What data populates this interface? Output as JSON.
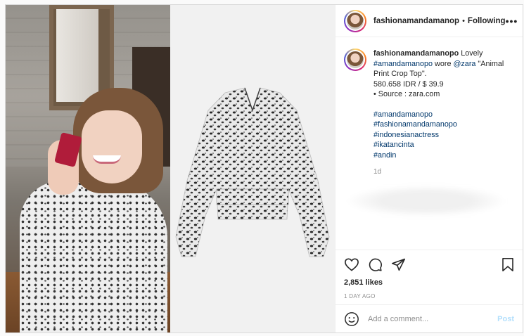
{
  "header": {
    "username": "fashionamandamanop",
    "separator": "•",
    "follow_status": "Following",
    "more_label": "•••"
  },
  "caption": {
    "username": "fashionamandamanopo",
    "line1_text": "Lovely",
    "mention_user": "#amandamanopo",
    "wore_text": "wore",
    "mention_brand": "@zara",
    "product_text": "\"Animal Print Crop Top\".",
    "price": "580.658 IDR / $ 39.9",
    "source": "• Source : zara.com",
    "hashtags": [
      "#amandamanopo",
      "#fashionamandamanopo",
      "#indonesianactress",
      "#ikatancinta",
      "#andin"
    ],
    "time": "1d"
  },
  "actions": {
    "likes": "2,851 likes",
    "date": "1 DAY AGO"
  },
  "comment": {
    "placeholder": "Add a comment...",
    "post_label": "Post"
  },
  "icons": {
    "more": "more-icon",
    "like": "heart-icon",
    "comment": "comment-icon",
    "share": "share-icon",
    "save": "bookmark-icon",
    "emoji": "emoji-icon"
  },
  "colors": {
    "link": "#00376b",
    "muted": "#8e8e8e",
    "post_button": "#b2dffc",
    "border": "#dbdbdb"
  }
}
